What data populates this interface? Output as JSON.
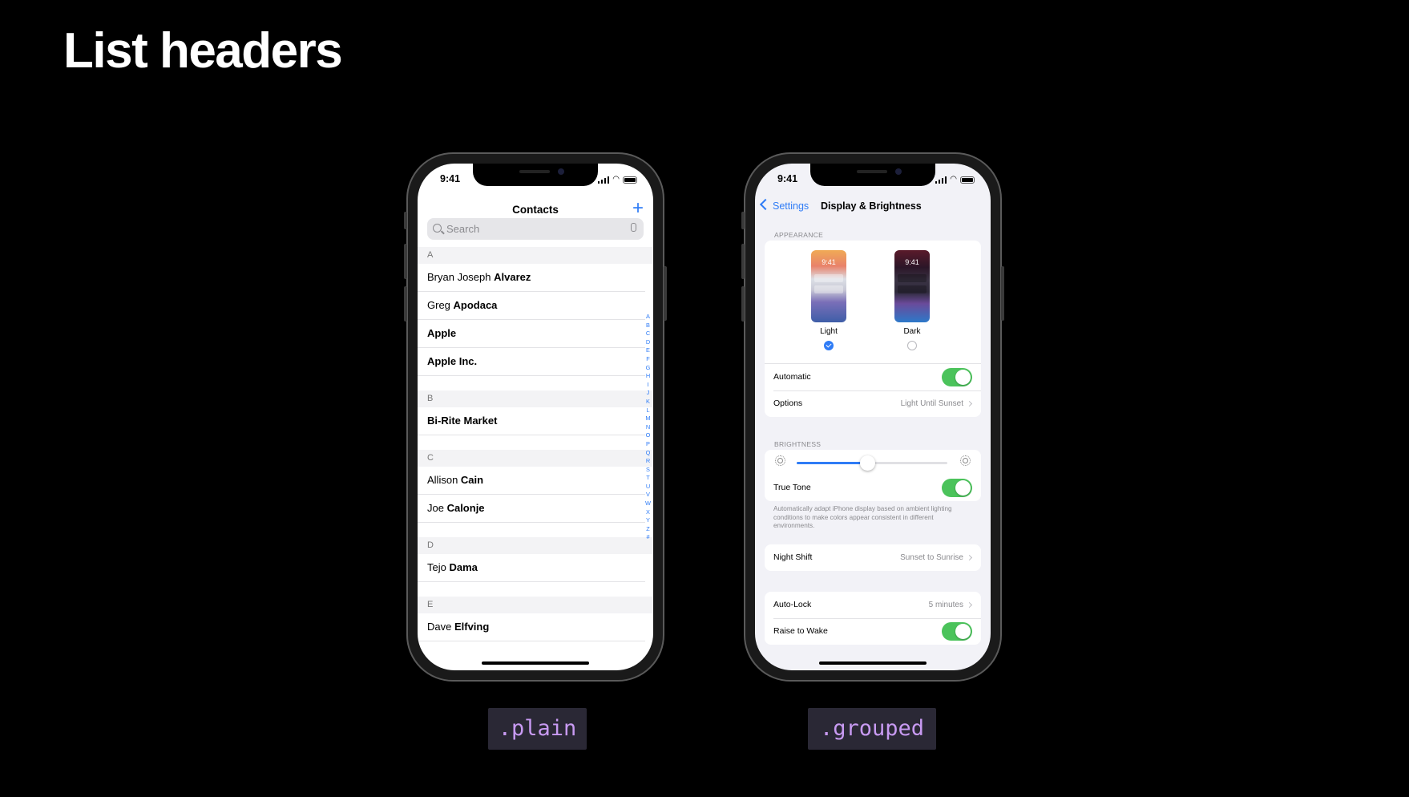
{
  "slide": {
    "title": "List headers"
  },
  "contacts_phone": {
    "time": "9:41",
    "nav_title": "Contacts",
    "add_icon": "+",
    "search_placeholder": "Search",
    "sections": [
      {
        "letter": "A",
        "rows": [
          {
            "first": "Bryan Joseph ",
            "last": "Alvarez"
          },
          {
            "first": "Greg ",
            "last": "Apodaca"
          },
          {
            "first": "",
            "last": "Apple"
          },
          {
            "first": "",
            "last": "Apple Inc."
          }
        ]
      },
      {
        "letter": "B",
        "rows": [
          {
            "first": "",
            "last": "Bi-Rite Market"
          }
        ]
      },
      {
        "letter": "C",
        "rows": [
          {
            "first": "Allison ",
            "last": "Cain"
          },
          {
            "first": "Joe ",
            "last": "Calonje"
          }
        ]
      },
      {
        "letter": "D",
        "rows": [
          {
            "first": "Tejo ",
            "last": "Dama"
          }
        ]
      },
      {
        "letter": "E",
        "rows": [
          {
            "first": "Dave ",
            "last": "Elfving"
          }
        ]
      }
    ],
    "index_letters": [
      "A",
      "B",
      "C",
      "D",
      "E",
      "F",
      "G",
      "H",
      "I",
      "J",
      "K",
      "L",
      "M",
      "N",
      "O",
      "P",
      "Q",
      "R",
      "S",
      "T",
      "U",
      "V",
      "W",
      "X",
      "Y",
      "Z",
      "#"
    ],
    "caption": ".plain"
  },
  "settings_phone": {
    "time": "9:41",
    "back_label": "Settings",
    "title": "Display & Brightness",
    "appearance_header": "APPEARANCE",
    "light_preview_time": "9:41",
    "dark_preview_time": "9:41",
    "light_label": "Light",
    "dark_label": "Dark",
    "selected_appearance": "Light",
    "automatic_label": "Automatic",
    "automatic_on": true,
    "options_label": "Options",
    "options_value": "Light Until Sunset",
    "brightness_header": "BRIGHTNESS",
    "brightness_level": 0.47,
    "true_tone_label": "True Tone",
    "true_tone_on": true,
    "true_tone_footnote": "Automatically adapt iPhone display based on ambient lighting conditions to make colors appear consistent in different environments.",
    "night_shift_label": "Night Shift",
    "night_shift_value": "Sunset to Sunrise",
    "auto_lock_label": "Auto-Lock",
    "auto_lock_value": "5 minutes",
    "raise_to_wake_label": "Raise to Wake",
    "raise_to_wake_on": true,
    "caption": ".grouped"
  },
  "colors": {
    "accent": "#2f7cf6",
    "toggle_on": "#4bc35b",
    "caption_text": "#c89af2",
    "caption_bg": "#2a2835"
  }
}
